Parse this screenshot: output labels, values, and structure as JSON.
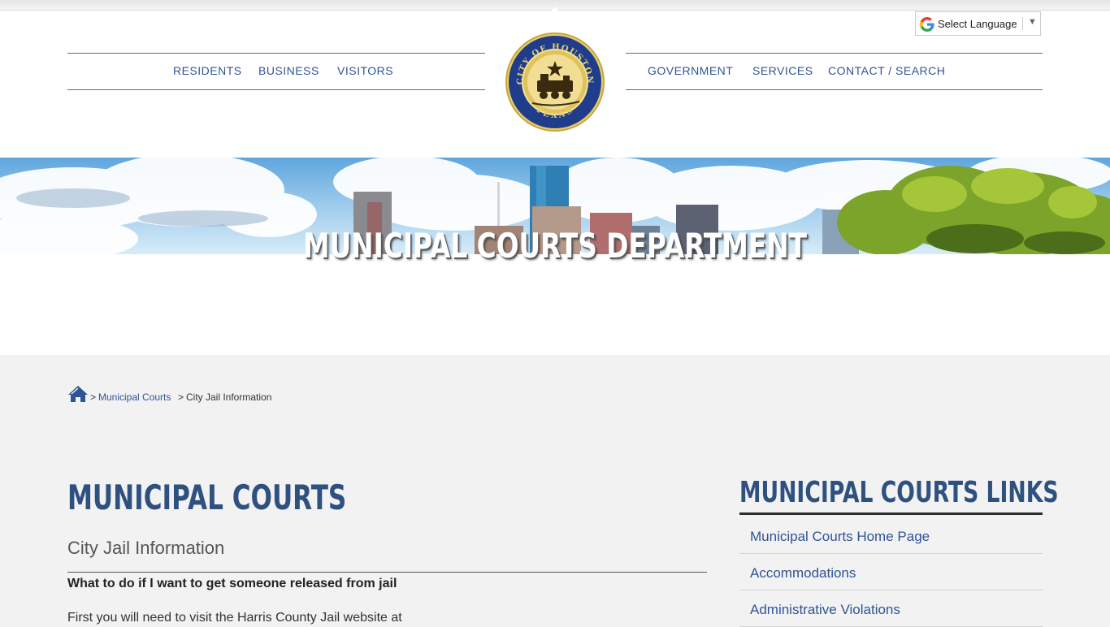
{
  "language_selector": {
    "label": "Select Language",
    "arrow": "▼",
    "icon": "google-g-icon"
  },
  "nav": {
    "left": [
      "RESIDENTS",
      "BUSINESS",
      "VISITORS"
    ],
    "right": [
      "GOVERNMENT",
      "SERVICES",
      "CONTACT / SEARCH"
    ]
  },
  "seal": {
    "top_text": "CITY OF HOUSTON",
    "bottom_text": "TEXAS"
  },
  "banner": {
    "title": "MUNICIPAL COURTS DEPARTMENT"
  },
  "breadcrumb": {
    "home_icon": "home-icon",
    "sep": ">",
    "link": "Municipal Courts",
    "current": "City Jail Information"
  },
  "main": {
    "title": "MUNICIPAL COURTS",
    "subtitle": "City Jail Information",
    "question": "What to do if I want to get someone released from jail",
    "para": "First you will need to visit the Harris County Jail website at"
  },
  "sidebar": {
    "title": "MUNICIPAL COURTS LINKS",
    "links": [
      "Municipal Courts Home Page",
      "Accommodations",
      "Administrative Violations"
    ]
  },
  "colors": {
    "link_blue": "#2f5496",
    "heading_blue": "#2f5180",
    "page_bg": "#f2f2f2"
  }
}
